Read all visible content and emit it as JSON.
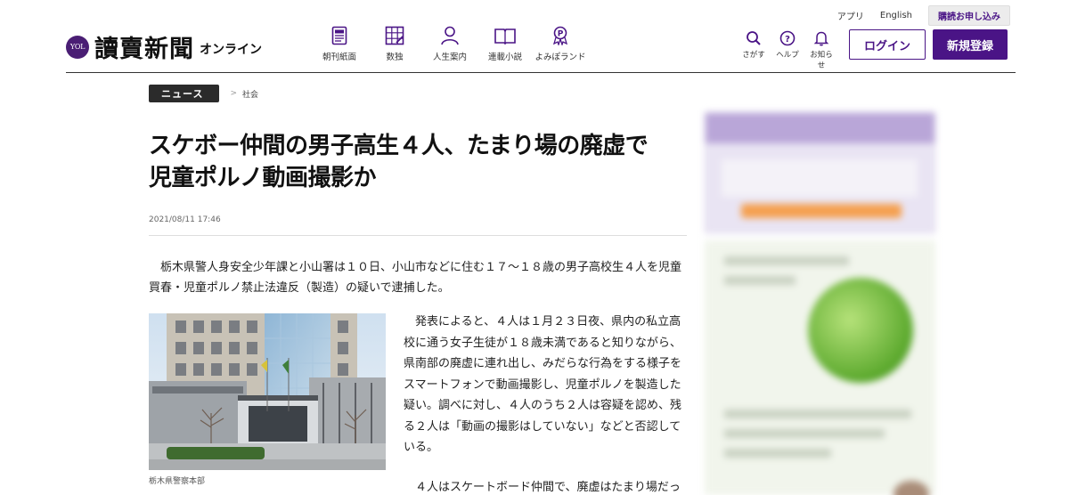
{
  "utility": {
    "app": "アプリ",
    "english": "English",
    "subscribe": "購読お申し込み"
  },
  "logo": {
    "badge": "YOL",
    "title": "讀賣新聞",
    "sub": "オンライン"
  },
  "nav": [
    {
      "label": "朝刊紙面",
      "icon": "newspaper-icon"
    },
    {
      "label": "数独",
      "icon": "sudoku-grid-icon"
    },
    {
      "label": "人生案内",
      "icon": "person-icon"
    },
    {
      "label": "連載小説",
      "icon": "book-icon"
    },
    {
      "label": "よみぽランド",
      "icon": "points-medal-icon"
    }
  ],
  "tools": [
    {
      "label": "さがす",
      "icon": "search-icon"
    },
    {
      "label": "ヘルプ",
      "icon": "help-icon"
    },
    {
      "label": "お知らせ",
      "icon": "bell-icon"
    }
  ],
  "auth": {
    "login": "ログイン",
    "register": "新規登録"
  },
  "breadcrumb": {
    "section": "ニュース",
    "separator": ">",
    "category": "社会"
  },
  "article": {
    "title_line1": "スケボー仲間の男子高生４人、たまり場の廃虚で",
    "title_line2": "児童ポルノ動画撮影か",
    "date": "2021/08/11 17:46",
    "lead": "栃木県警人身安全少年課と小山署は１０日、小山市などに住む１７〜１８歳の男子高校生４人を児童買春・児童ポルノ禁止法違反（製造）の疑いで逮捕した。",
    "photo_caption": "栃木県警察本部",
    "para1": "発表によると、４人は１月２３日夜、県内の私立高校に通う女子生徒が１８歳未満であると知りながら、県南部の廃虚に連れ出し、みだらな行為をする様子をスマートフォンで動画撮影し、児童ポルノを製造した疑い。調べに対し、４人のうち２人は容疑を認め、残る２人は「動画の撮影はしていない」などと否認している。",
    "para2": "４人はスケートボード仲間で、廃虚はたまり場だっ"
  },
  "colors": {
    "brand": "#4a1486",
    "logo_badge": "#4a1e74"
  }
}
